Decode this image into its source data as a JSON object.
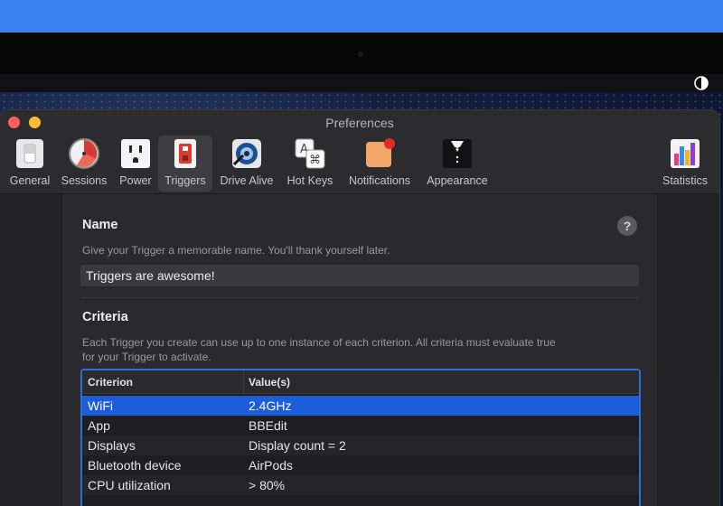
{
  "window": {
    "title": "Preferences"
  },
  "toolbar": {
    "items": [
      {
        "label": "General"
      },
      {
        "label": "Sessions"
      },
      {
        "label": "Power"
      },
      {
        "label": "Triggers"
      },
      {
        "label": "Drive Alive"
      },
      {
        "label": "Hot Keys"
      },
      {
        "label": "Notifications"
      },
      {
        "label": "Appearance"
      },
      {
        "label": "Statistics"
      }
    ],
    "active": "Triggers"
  },
  "name_section": {
    "title": "Name",
    "description": "Give your Trigger a memorable name. You'll thank yourself later.",
    "value": "Triggers are awesome!",
    "help": "?"
  },
  "criteria_section": {
    "title": "Criteria",
    "description_line1": "Each Trigger you create can use up to one instance of each criterion. All criteria must evaluate true",
    "description_line2": "for your Trigger to activate.",
    "columns": [
      "Criterion",
      "Value(s)"
    ],
    "rows": [
      {
        "criterion": "WiFi",
        "value": "2.4GHz",
        "selected": true
      },
      {
        "criterion": "App",
        "value": "BBEdit"
      },
      {
        "criterion": "Displays",
        "value": "Display count = 2"
      },
      {
        "criterion": "Bluetooth device",
        "value": "AirPods"
      },
      {
        "criterion": "CPU utilization",
        "value": "> 80%"
      }
    ]
  },
  "colors": {
    "accent": "#1d5ed8",
    "focus_ring": "#2f6fcf",
    "close": "#fe5f57",
    "minimize": "#febc2e"
  }
}
